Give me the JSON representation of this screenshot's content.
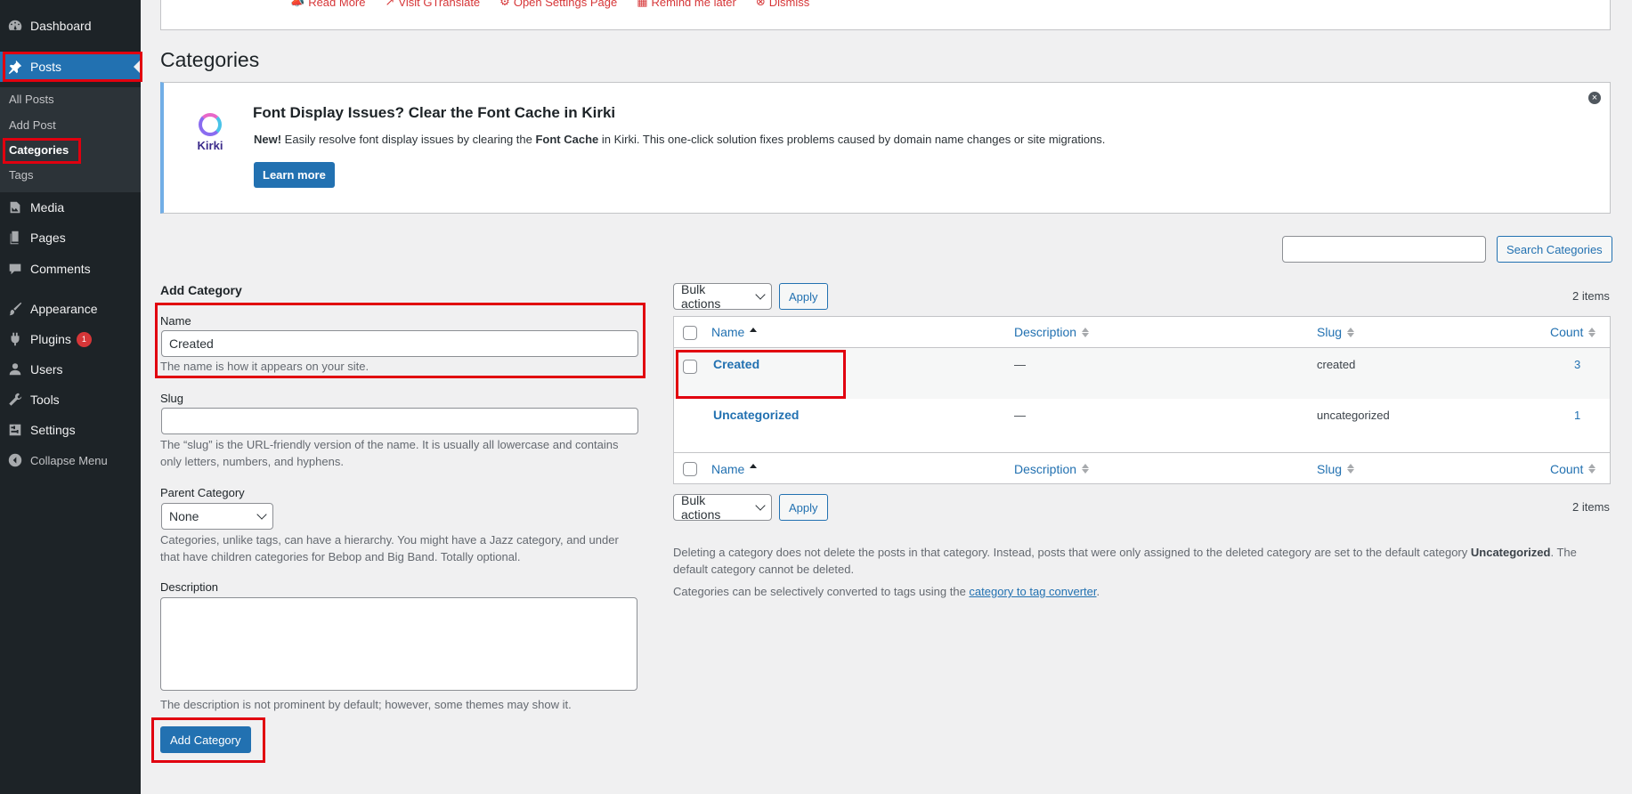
{
  "sidebar": {
    "dashboard": "Dashboard",
    "posts": "Posts",
    "sub": {
      "all_posts": "All Posts",
      "add_post": "Add Post",
      "categories": "Categories",
      "tags": "Tags"
    },
    "media": "Media",
    "pages": "Pages",
    "comments": "Comments",
    "appearance": "Appearance",
    "plugins": "Plugins",
    "plugins_badge": "1",
    "users": "Users",
    "tools": "Tools",
    "settings": "Settings",
    "collapse": "Collapse Menu"
  },
  "top_notice": {
    "links": [
      "Read More",
      "Visit GTranslate",
      "Open Settings Page",
      "Remind me later",
      "Dismiss"
    ]
  },
  "page_title": "Categories",
  "kirki": {
    "logo_text": "Kirki",
    "title": "Font Display Issues? Clear the Font Cache in Kirki",
    "text_new": "New!",
    "text_part1": " Easily resolve font display issues by clearing the ",
    "text_bold": "Font Cache",
    "text_part2": " in Kirki. This one-click solution fixes problems caused by domain name changes or site migrations.",
    "button": "Learn more",
    "close": "×"
  },
  "search": {
    "value": "",
    "button": "Search Categories"
  },
  "form": {
    "heading": "Add Category",
    "name_label": "Name",
    "name_value": "Created",
    "name_help": "The name is how it appears on your site.",
    "slug_label": "Slug",
    "slug_value": "",
    "slug_help": "The “slug” is the URL-friendly version of the name. It is usually all lowercase and contains only letters, numbers, and hyphens.",
    "parent_label": "Parent Category",
    "parent_value": "None",
    "parent_help": "Categories, unlike tags, can have a hierarchy. You might have a Jazz category, and under that have children categories for Bebop and Big Band. Totally optional.",
    "description_label": "Description",
    "description_help": "The description is not prominent by default; however, some themes may show it.",
    "submit": "Add Category"
  },
  "table": {
    "bulk_actions": "Bulk actions",
    "apply": "Apply",
    "items_count": "2 items",
    "columns": {
      "name": "Name",
      "description": "Description",
      "slug": "Slug",
      "count": "Count"
    },
    "rows": [
      {
        "name": "Created",
        "description": "—",
        "slug": "created",
        "count": "3"
      },
      {
        "name": "Uncategorized",
        "description": "—",
        "slug": "uncategorized",
        "count": "1"
      }
    ]
  },
  "notes": {
    "delete_part1": "Deleting a category does not delete the posts in that category. Instead, posts that were only assigned to the deleted category are set to the default category ",
    "delete_bold": "Uncategorized",
    "delete_part2": ". The default category cannot be deleted.",
    "convert_part1": "Categories can be selectively converted to tags using the ",
    "convert_link": "category to tag converter",
    "convert_part2": "."
  },
  "colors": {
    "accent": "#2271b1",
    "sidebar_bg": "#1d2327",
    "highlight_box": "#e1000f"
  }
}
